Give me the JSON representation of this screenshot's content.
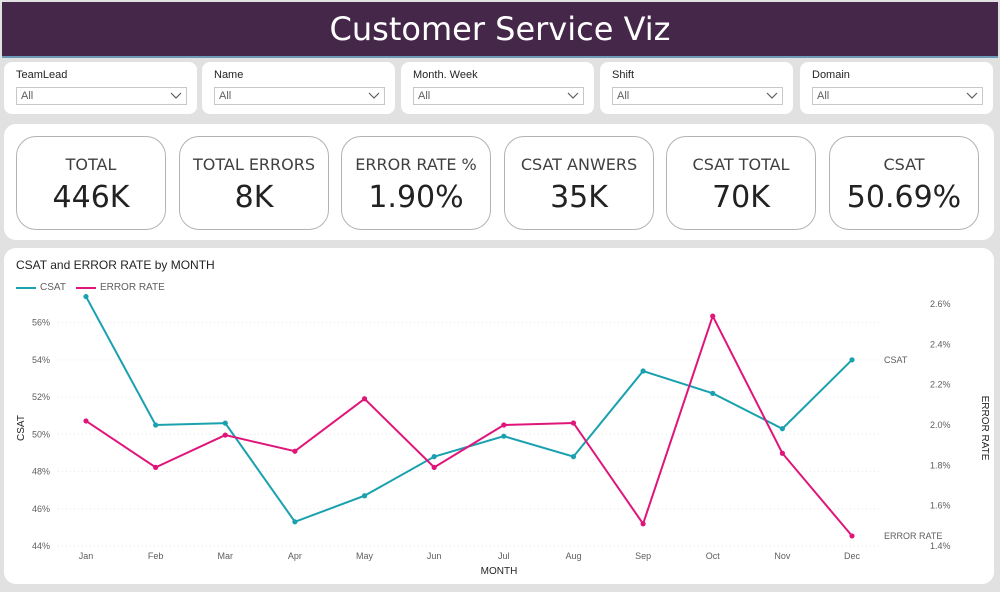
{
  "header": {
    "title": "Customer Service Viz"
  },
  "slicers": [
    {
      "label": "TeamLead",
      "value": "All"
    },
    {
      "label": "Name",
      "value": "All"
    },
    {
      "label": "Month. Week",
      "value": "All"
    },
    {
      "label": "Shift",
      "value": "All"
    },
    {
      "label": "Domain",
      "value": "All"
    }
  ],
  "kpis": [
    {
      "title": "TOTAL",
      "value": "446K"
    },
    {
      "title": "TOTAL ERRORS",
      "value": "8K"
    },
    {
      "title": "ERROR RATE %",
      "value": "1.90%"
    },
    {
      "title": "CSAT ANWERS",
      "value": "35K"
    },
    {
      "title": "CSAT TOTAL",
      "value": "70K"
    },
    {
      "title": "CSAT",
      "value": "50.69%"
    }
  ],
  "chart": {
    "title": "CSAT and ERROR RATE by MONTH",
    "colors": {
      "csat": "#1aa1b0",
      "error": "#e0157a"
    }
  },
  "chart_data": {
    "type": "line",
    "title": "CSAT and ERROR RATE by MONTH",
    "xlabel": "MONTH",
    "ylabel": "CSAT",
    "y2label": "ERROR RATE",
    "categories": [
      "Jan",
      "Feb",
      "Mar",
      "Apr",
      "May",
      "Jun",
      "Jul",
      "Aug",
      "Sep",
      "Oct",
      "Nov",
      "Dec"
    ],
    "ylim": [
      44,
      57
    ],
    "yticks": [
      "44%",
      "46%",
      "48%",
      "50%",
      "52%",
      "54%",
      "56%"
    ],
    "y2lim": [
      1.4,
      2.6
    ],
    "y2ticks": [
      "1.4%",
      "1.6%",
      "1.8%",
      "2.0%",
      "2.2%",
      "2.4%",
      "2.6%"
    ],
    "grid": true,
    "legend": "top-left",
    "series": [
      {
        "name": "CSAT",
        "axis": "left",
        "end_label": "CSAT",
        "values": [
          57.4,
          50.5,
          50.6,
          45.3,
          46.7,
          48.8,
          49.9,
          48.8,
          53.4,
          52.2,
          50.3,
          54.0
        ]
      },
      {
        "name": "ERROR RATE",
        "axis": "right",
        "end_label": "ERROR RATE",
        "values": [
          2.02,
          1.79,
          1.95,
          1.87,
          2.13,
          1.79,
          2.0,
          2.01,
          1.51,
          2.54,
          1.86,
          1.45
        ]
      }
    ]
  }
}
